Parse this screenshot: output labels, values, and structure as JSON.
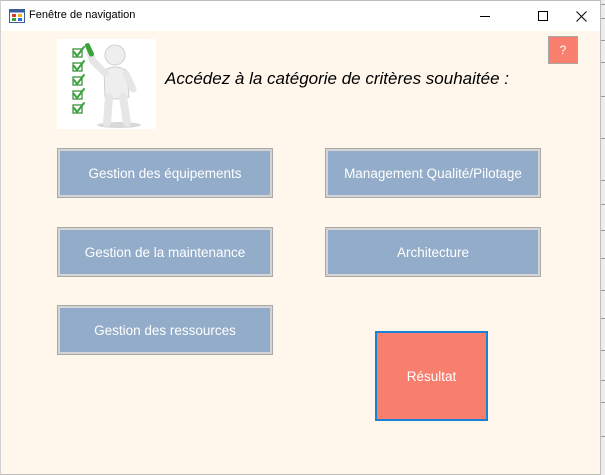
{
  "window": {
    "title": "Fenêtre de navigation",
    "heading": "Accédez à la catégorie de critères souhaitée :",
    "help_label": "?"
  },
  "icons": {
    "app": "app-window-icon",
    "minimize": "minimize-icon",
    "maximize": "maximize-icon",
    "close": "close-icon",
    "illustration": "checklist-figure-illustration"
  },
  "buttons": {
    "gestion_equipements": "Gestion des équipements",
    "management_qualite": "Management Qualité/Pilotage",
    "gestion_maintenance": "Gestion de la maintenance",
    "architecture": "Architecture",
    "gestion_ressources": "Gestion des ressources",
    "resultat": "Résultat"
  },
  "colors": {
    "window_background": "#fff7eb",
    "category_button": "#92acc9",
    "accent_button": "#f87e6e",
    "focus_border": "#1e7fd6",
    "checkmark_green": "#3aa23a"
  }
}
